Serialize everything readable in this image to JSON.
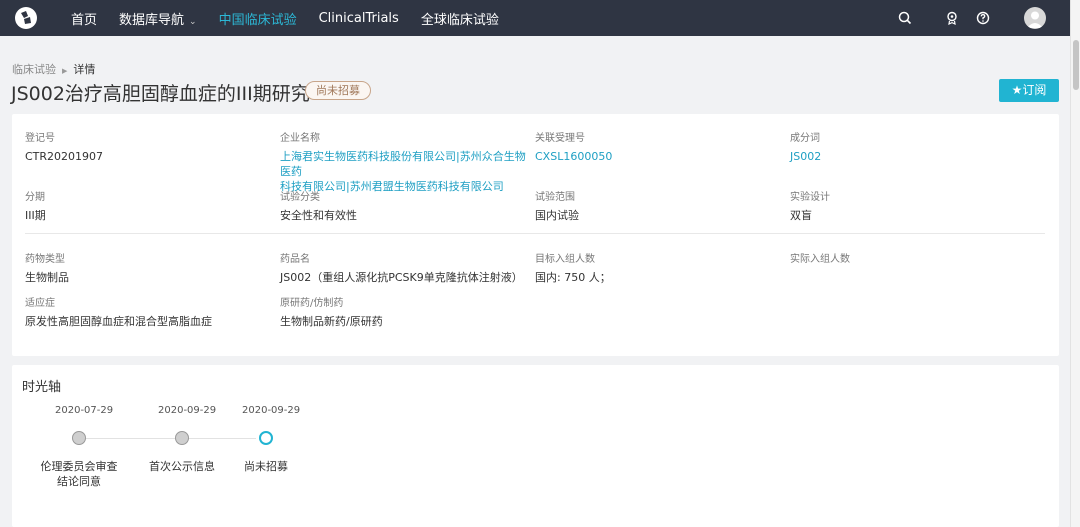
{
  "nav": {
    "items": [
      {
        "label": "首页"
      },
      {
        "label": "数据库导航",
        "caret": "⌄"
      },
      {
        "label": "中国临床试验",
        "active": true
      },
      {
        "label": "ClinicalTrials"
      },
      {
        "label": "全球临床试验"
      }
    ],
    "icons": [
      "search-icon",
      "trophy-icon",
      "help-icon",
      "user-avatar"
    ]
  },
  "breadcrumb": {
    "parent": "临床试验",
    "sep": "▶",
    "current": "详情"
  },
  "title": "JS002治疗高胆固醇血症的III期研究",
  "status": "尚未招募",
  "subscribe_label": "★订阅",
  "details": {
    "reg_no_label": "登记号",
    "reg_no": "CTR20201907",
    "company_label": "企业名称",
    "company": "上海君实生物医药科技股份有限公司|苏州众合生物医药",
    "company_line2": "科技有限公司|苏州君盟生物医药科技有限公司",
    "related_label": "关联受理号",
    "related": "CXSL1600050",
    "ingredient_label": "成分词",
    "ingredient": "JS002",
    "phase_label": "分期",
    "phase": "III期",
    "trial_cat_label": "试验分类",
    "trial_cat": "安全性和有效性",
    "scope_label": "试验范围",
    "scope": "国内试验",
    "design_label": "实验设计",
    "design": "双盲",
    "drug_type_label": "药物类型",
    "drug_type": "生物制品",
    "drug_name_label": "药品名",
    "drug_name": "JS002（重组人源化抗PCSK9单克隆抗体注射液）",
    "target_enroll_label": "目标入组人数",
    "target_enroll": "国内: 750 人；",
    "actual_enroll_label": "实际入组人数",
    "indication_label": "适应症",
    "indication": "原发性高胆固醇血症和混合型高脂血症",
    "origin_label": "原研药/仿制药",
    "origin": "生物制品新药/原研药"
  },
  "timeline": {
    "title": "时光轴",
    "events": [
      {
        "date": "2020-07-29",
        "label": "伦理委员会审查",
        "label2": "结论同意"
      },
      {
        "date": "2020-09-29",
        "label": "首次公示信息"
      },
      {
        "date": "2020-09-29",
        "label": "尚未招募"
      }
    ]
  },
  "colors": {
    "accent": "#21b4d2",
    "nav_bg": "#2f3543"
  }
}
